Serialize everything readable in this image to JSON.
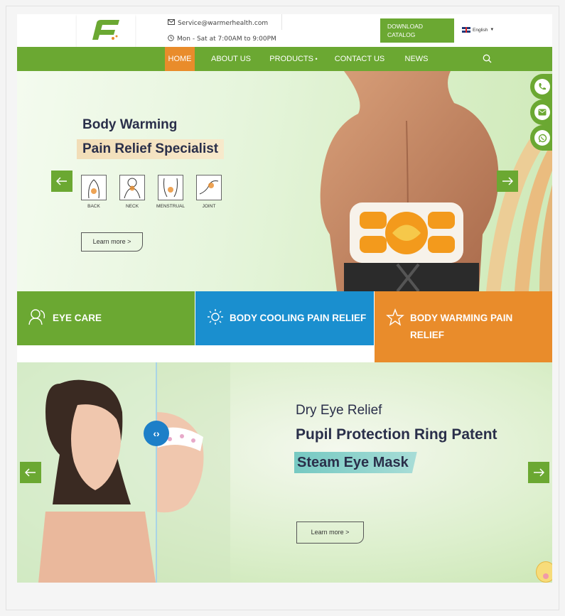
{
  "header": {
    "email": "Service@warmerhealth.com",
    "hours": "Mon - Sat at 7:00AM to 9:00PM",
    "download_line1": "DOWNLOAD",
    "download_line2": "CATALOG",
    "language": "English"
  },
  "nav": {
    "items": [
      {
        "label": "HOME"
      },
      {
        "label": "ABOUT US"
      },
      {
        "label": "PRODUCTS"
      },
      {
        "label": "CONTACT US"
      },
      {
        "label": "NEWS"
      }
    ]
  },
  "hero": {
    "line1": "Body Warming",
    "line2": "Pain Relief Specialist",
    "pain_points": [
      "BACK",
      "NECK",
      "MENSTRUAL",
      "JOINT"
    ],
    "learn_more": "Learn more  >"
  },
  "categories": [
    {
      "label": "EYE CARE",
      "color": "#6ba832"
    },
    {
      "label": "BODY COOLING PAIN RELIEF",
      "color": "#1a8fcf"
    },
    {
      "label": "BODY WARMING PAIN RELIEF",
      "color": "#e98c2b"
    }
  ],
  "hero2": {
    "line1": "Dry Eye Relief",
    "line2": "Pupil Protection Ring Patent",
    "line3": "Steam Eye Mask",
    "learn_more": "Learn more  >"
  },
  "colors": {
    "brand_green": "#6ba832",
    "accent_orange": "#e98c2b",
    "accent_blue": "#1a8fcf"
  },
  "icons": [
    "phone-icon",
    "email-icon",
    "whatsapp-icon",
    "search-icon",
    "clock-icon",
    "mail-outline-icon"
  ]
}
